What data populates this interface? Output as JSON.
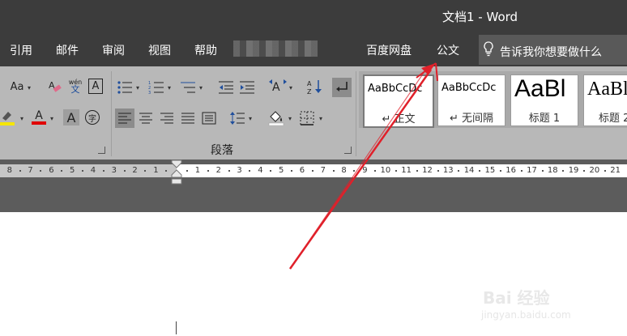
{
  "window": {
    "title": "文档1 - Word"
  },
  "tabs": [
    {
      "label": "引用"
    },
    {
      "label": "邮件"
    },
    {
      "label": "审阅"
    },
    {
      "label": "视图"
    },
    {
      "label": "帮助"
    },
    {
      "label": "百度网盘"
    },
    {
      "label": "公文"
    }
  ],
  "tell_me": {
    "text": "告诉我你想要做什么",
    "icon": "lightbulb-icon"
  },
  "font_group": {
    "case_label": "Aa",
    "clear_icon": "eraser-icon",
    "phonetic_top": "wén",
    "phonetic_bottom": "文",
    "border_char_label": "A",
    "font_color_label": "A",
    "char_shading_label": "A",
    "enclose_char_label": "字",
    "highlight_color": "#f5e600",
    "font_color": "#e00000"
  },
  "paragraph_group": {
    "label": "段落"
  },
  "styles": [
    {
      "sample": "AaBbCcDc",
      "name": "↵ 正文"
    },
    {
      "sample": "AaBbCcDc",
      "name": "↵ 无间隔"
    },
    {
      "sample": "AaBl",
      "name": "标题 1"
    },
    {
      "sample": "AaBl",
      "name": "标题 2"
    }
  ],
  "ruler": {
    "left_numbers": [
      "8",
      "7",
      "6",
      "5",
      "4",
      "3",
      "2",
      "1"
    ],
    "right_numbers": [
      "1",
      "2",
      "3",
      "4",
      "5",
      "6",
      "7",
      "8",
      "9",
      "10",
      "11",
      "12",
      "13",
      "14",
      "15",
      "16",
      "17",
      "18",
      "19",
      "20",
      "21"
    ]
  },
  "watermark": {
    "main": "Bai 经验",
    "sub": "jingyan.baidu.com"
  },
  "colors": {
    "titlebar": "#3c3c3c",
    "ribbon": "#b8b8b8",
    "annotation_arrow": "#e0202a"
  }
}
